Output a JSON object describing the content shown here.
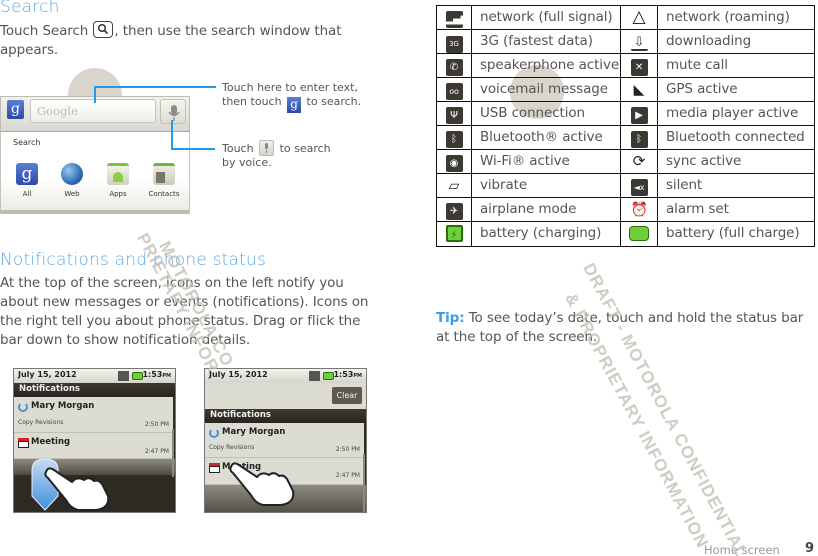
{
  "search_section": {
    "title": "Search",
    "body_before": "Touch Search ",
    "search_key_icon": "search-icon",
    "body_after": ", then use the search window that appears.",
    "widget": {
      "field_placeholder": "Google",
      "list_label": "Search",
      "apps": [
        {
          "label": "All",
          "icon": "google-icon"
        },
        {
          "label": "Web",
          "icon": "globe-icon"
        },
        {
          "label": "Apps",
          "icon": "market-icon"
        },
        {
          "label": "Contacts",
          "icon": "contacts-icon"
        }
      ]
    },
    "callout_text": {
      "line1": "Touch here to enter text,",
      "line2_before": "then touch ",
      "line2_after": " to search."
    },
    "callout_voice": {
      "before": "Touch ",
      "after": " to search",
      "line2": "by voice."
    }
  },
  "notifications_section": {
    "title": "Notifications and phone status",
    "body": "At the top of the screen, icons on the left notify you about new messages or events (notifications). Icons on the right tell you about phone status. Drag or flick the bar down to show notification details.",
    "screens": [
      {
        "date": "July 15, 2012",
        "time": "1:53",
        "ampm": "PM",
        "header": "Notifications",
        "items": [
          {
            "name": "Mary Morgan",
            "sub": "Copy Revisions",
            "time": "2:50 PM",
            "icon": "sync-icon"
          },
          {
            "name": "Meeting",
            "sub": "",
            "time": "2:47 PM",
            "icon": "calendar-icon"
          }
        ]
      },
      {
        "date": "July 15, 2012",
        "time": "1:53",
        "ampm": "PM",
        "clear_label": "Clear",
        "header": "Notifications",
        "items": [
          {
            "name": "Mary Morgan",
            "sub": "Copy Revisions",
            "time": "2:50 PM",
            "icon": "sync-icon"
          },
          {
            "name": "Meeting",
            "sub": "",
            "time": "2:47 PM",
            "icon": "calendar-icon"
          }
        ]
      }
    ]
  },
  "status_icons": [
    {
      "left": {
        "icon": "signal-full-icon",
        "label": "network (full signal)"
      },
      "right": {
        "icon": "roaming-icon",
        "label": "network (roaming)"
      }
    },
    {
      "left": {
        "icon": "3g-icon",
        "label": "3G (fastest data)"
      },
      "right": {
        "icon": "download-icon",
        "label": "downloading"
      }
    },
    {
      "left": {
        "icon": "speakerphone-icon",
        "label": "speakerphone active"
      },
      "right": {
        "icon": "mute-call-icon",
        "label": "mute call"
      }
    },
    {
      "left": {
        "icon": "voicemail-icon",
        "label": "voicemail message"
      },
      "right": {
        "icon": "gps-icon",
        "label": "GPS active"
      }
    },
    {
      "left": {
        "icon": "usb-icon",
        "label": "USB connection"
      },
      "right": {
        "icon": "media-play-icon",
        "label": "media player active"
      }
    },
    {
      "left": {
        "icon": "bluetooth-icon",
        "label": "Bluetooth® active"
      },
      "right": {
        "icon": "bluetooth-connected-icon",
        "label": "Bluetooth connected"
      }
    },
    {
      "left": {
        "icon": "wifi-icon",
        "label": "Wi-Fi® active"
      },
      "right": {
        "icon": "sync-icon",
        "label": "sync active"
      }
    },
    {
      "left": {
        "icon": "vibrate-icon",
        "label": "vibrate"
      },
      "right": {
        "icon": "silent-icon",
        "label": "silent"
      }
    },
    {
      "left": {
        "icon": "airplane-icon",
        "label": "airplane mode"
      },
      "right": {
        "icon": "alarm-icon",
        "label": "alarm set"
      }
    },
    {
      "left": {
        "icon": "battery-charging-icon",
        "label": "battery (charging)"
      },
      "right": {
        "icon": "battery-full-icon",
        "label": "battery (full charge)"
      }
    }
  ],
  "tip": {
    "label": "Tip:",
    "text": " To see today’s date, touch and hold the status bar at the top of the screen."
  },
  "footer": {
    "section": "Home screen",
    "page": "9"
  },
  "watermark": {
    "line1": "DRAFT - MOTOROLA CONFIDENTIAL",
    "line2": "& PROPRIETARY INFORMATION",
    "left_line1": "MOTOROLA CO",
    "left_line2": "PRIETARY INFOR"
  },
  "colors": {
    "heading": "#5fa9e6",
    "tip": "#3d9be6",
    "callout": "#1f9bea",
    "battery_green": "#6ecf3c"
  }
}
